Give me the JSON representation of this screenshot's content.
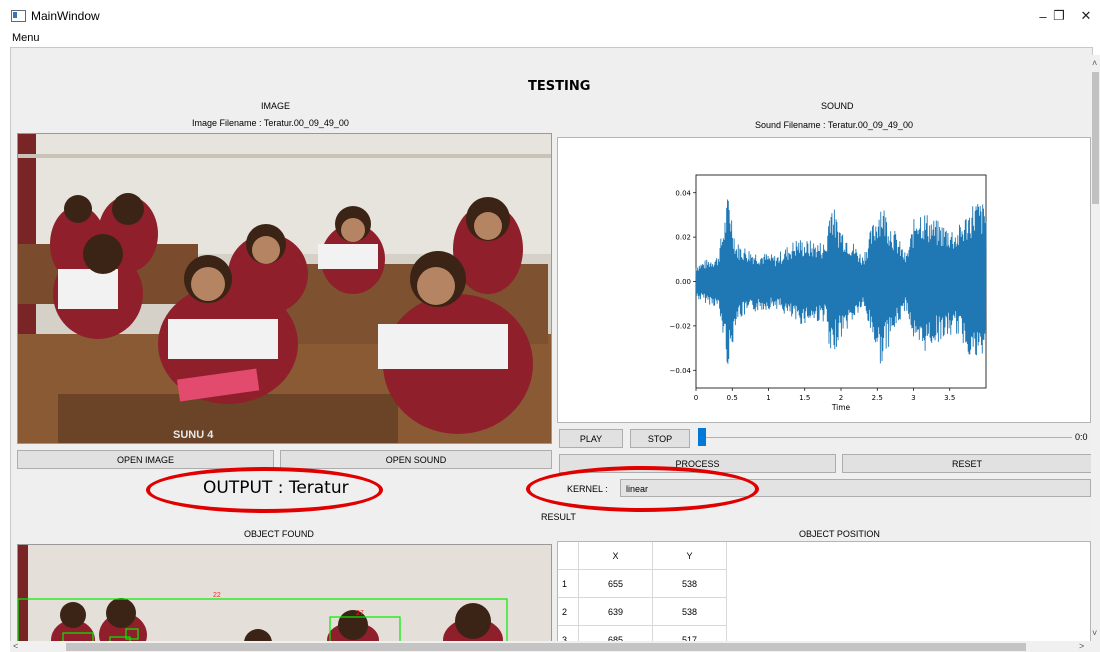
{
  "window": {
    "title": "MainWindow",
    "minimize": "–",
    "restore": "❐",
    "close": "✕"
  },
  "menu": {
    "items": [
      "Menu"
    ]
  },
  "page": {
    "heading": "TESTING"
  },
  "image_panel": {
    "title": "IMAGE",
    "filename": "Image Filename : Teratur.00_09_49_00",
    "open_button": "OPEN IMAGE",
    "photo_sign": "SUNU 4"
  },
  "sound_panel": {
    "title": "SOUND",
    "filename": "Sound Filename : Teratur.00_09_49_00",
    "open_button": "OPEN SOUND",
    "play_button": "PLAY",
    "stop_button": "STOP",
    "time": "0:0",
    "progress": 0
  },
  "process": {
    "process_button": "PROCESS",
    "reset_button": "RESET"
  },
  "output": {
    "text": "OUTPUT : Teratur"
  },
  "kernel": {
    "label": "KERNEL :",
    "value": "linear"
  },
  "result": {
    "title": "RESULT",
    "object_found_title": "OBJECT FOUND",
    "object_position_title": "OBJECT POSITION"
  },
  "detections": {
    "labels": [
      "22",
      "27"
    ]
  },
  "positions": {
    "headers": [
      "X",
      "Y"
    ],
    "rows": [
      {
        "index": "1",
        "x": "655",
        "y": "538"
      },
      {
        "index": "2",
        "x": "639",
        "y": "538"
      },
      {
        "index": "3",
        "x": "685",
        "y": "517"
      }
    ]
  },
  "colors": {
    "waveform": "#1f77b4",
    "annotation": "#e10000",
    "detection_box": "#00ee00",
    "slider": "#0078d7"
  },
  "chart_data": {
    "type": "line",
    "title": "",
    "xlabel": "Time",
    "ylabel": "",
    "xlim": [
      0,
      4.0
    ],
    "ylim": [
      -0.048,
      0.048
    ],
    "x_ticks": [
      "0",
      "0.5",
      "1",
      "1.5",
      "2",
      "2.5",
      "3",
      "3.5"
    ],
    "y_ticks": [
      "0.04",
      "0.02",
      "0.00",
      "−0.02",
      "−0.04"
    ],
    "series": [
      {
        "envelope": [
          {
            "t": 0.0,
            "a": 0.008
          },
          {
            "t": 0.3,
            "a": 0.012
          },
          {
            "t": 0.4,
            "a": 0.03
          },
          {
            "t": 0.45,
            "a": 0.042
          },
          {
            "t": 0.55,
            "a": 0.018
          },
          {
            "t": 0.8,
            "a": 0.014
          },
          {
            "t": 1.1,
            "a": 0.012
          },
          {
            "t": 1.4,
            "a": 0.02
          },
          {
            "t": 1.5,
            "a": 0.019
          },
          {
            "t": 1.8,
            "a": 0.018
          },
          {
            "t": 1.85,
            "a": 0.04
          },
          {
            "t": 1.95,
            "a": 0.028
          },
          {
            "t": 2.3,
            "a": 0.012
          },
          {
            "t": 2.55,
            "a": 0.038
          },
          {
            "t": 2.65,
            "a": 0.03
          },
          {
            "t": 2.9,
            "a": 0.012
          },
          {
            "t": 3.05,
            "a": 0.035
          },
          {
            "t": 3.3,
            "a": 0.028
          },
          {
            "t": 3.6,
            "a": 0.024
          },
          {
            "t": 3.85,
            "a": 0.038
          },
          {
            "t": 4.0,
            "a": 0.035
          }
        ]
      }
    ]
  }
}
